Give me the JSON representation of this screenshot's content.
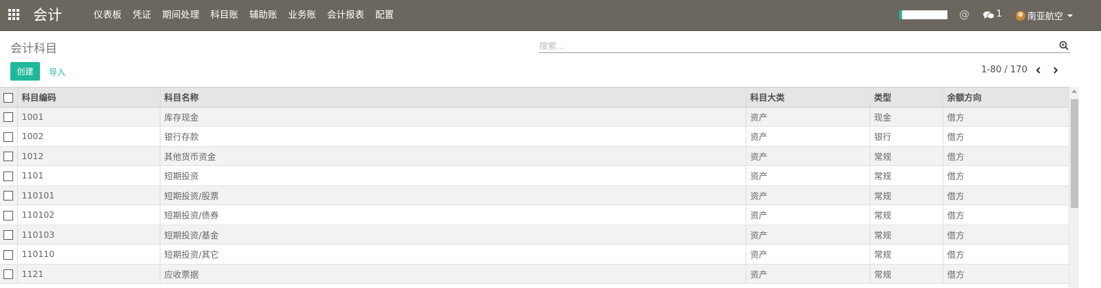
{
  "navbar": {
    "app_title": "会计",
    "menu": [
      "仪表板",
      "凭证",
      "期间处理",
      "科目账",
      "辅助账",
      "业务账",
      "会计报表",
      "配置"
    ],
    "at_symbol": "@",
    "chat_count": "1",
    "user_name": "南亚航空"
  },
  "control": {
    "page_title": "会计科目",
    "search_placeholder": "搜索...",
    "create_label": "创建",
    "import_label": "导入",
    "pager": "1-80 / 170"
  },
  "table": {
    "headers": [
      "科目编码",
      "科目名称",
      "科目大类",
      "类型",
      "余额方向"
    ],
    "rows": [
      [
        "1001",
        "库存现金",
        "资产",
        "现金",
        "借方"
      ],
      [
        "1002",
        "银行存款",
        "资产",
        "银行",
        "借方"
      ],
      [
        "1012",
        "其他货币资金",
        "资产",
        "常规",
        "借方"
      ],
      [
        "1101",
        "短期投资",
        "资产",
        "常规",
        "借方"
      ],
      [
        "110101",
        "短期投资/股票",
        "资产",
        "常规",
        "借方"
      ],
      [
        "110102",
        "短期投资/债券",
        "资产",
        "常规",
        "借方"
      ],
      [
        "110103",
        "短期投资/基金",
        "资产",
        "常规",
        "借方"
      ],
      [
        "110110",
        "短期投资/其它",
        "资产",
        "常规",
        "借方"
      ],
      [
        "1121",
        "应收票据",
        "资产",
        "常规",
        "借方"
      ]
    ]
  },
  "colors": {
    "navbar_bg": "#6b665e",
    "accent": "#21b799"
  },
  "icons": [
    "apps-grid-icon",
    "at-icon",
    "chat-icon",
    "avatar-icon",
    "chevron-down-icon",
    "search-icon",
    "chevron-left-icon",
    "chevron-right-icon"
  ]
}
